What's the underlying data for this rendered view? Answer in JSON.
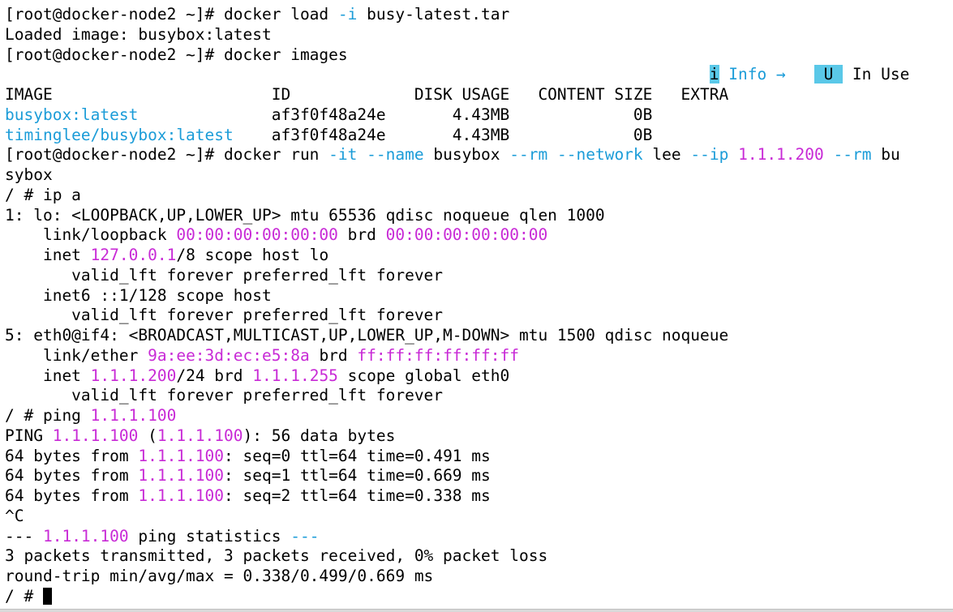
{
  "terminal": {
    "lines": [
      [
        {
          "t": "[root@docker-node2 ~]# docker load "
        },
        {
          "t": "-i",
          "c": "cyan"
        },
        {
          "t": " busy-latest.tar"
        }
      ],
      [
        {
          "t": "Loaded image: busybox:latest"
        }
      ],
      [
        {
          "t": "[root@docker-node2 ~]# docker images"
        }
      ],
      [
        {
          "t": "                                                                          "
        },
        {
          "t": "i",
          "c": "legend-i"
        },
        {
          "t": " Info → ",
          "c": "legend-info"
        },
        {
          "t": "  "
        },
        {
          "t": " U ",
          "c": "legend-u"
        },
        {
          "t": " In Use"
        }
      ],
      [
        {
          "t": "IMAGE                       ID             DISK USAGE   CONTENT SIZE   EXTRA"
        }
      ],
      [
        {
          "t": "busybox:latest",
          "c": "cyan"
        },
        {
          "t": "              af3f0f48a24e       4.43MB             0B"
        }
      ],
      [
        {
          "t": "timinglee/busybox:latest",
          "c": "cyan"
        },
        {
          "t": "    af3f0f48a24e       4.43MB             0B"
        }
      ],
      [
        {
          "t": "[root@docker-node2 ~]# docker run "
        },
        {
          "t": "-it",
          "c": "cyan"
        },
        {
          "t": " "
        },
        {
          "t": "--name",
          "c": "cyan"
        },
        {
          "t": " busybox "
        },
        {
          "t": "--rm",
          "c": "cyan"
        },
        {
          "t": " "
        },
        {
          "t": "--network",
          "c": "cyan"
        },
        {
          "t": " lee "
        },
        {
          "t": "--ip",
          "c": "cyan"
        },
        {
          "t": " "
        },
        {
          "t": "1.1.1.200",
          "c": "mag"
        },
        {
          "t": " "
        },
        {
          "t": "--rm",
          "c": "cyan"
        },
        {
          "t": " bu"
        }
      ],
      [
        {
          "t": "sybox"
        }
      ],
      [
        {
          "t": "/ # ip a"
        }
      ],
      [
        {
          "t": "1: lo: <LOOPBACK,UP,LOWER_UP> mtu 65536 qdisc noqueue qlen 1000"
        }
      ],
      [
        {
          "t": "    link/loopback "
        },
        {
          "t": "00:00:00:00:00:00",
          "c": "mag"
        },
        {
          "t": " brd "
        },
        {
          "t": "00:00:00:00:00:00",
          "c": "mag"
        }
      ],
      [
        {
          "t": "    inet "
        },
        {
          "t": "127.0.0.1",
          "c": "mag"
        },
        {
          "t": "/8 scope host lo"
        }
      ],
      [
        {
          "t": "       valid_lft forever preferred_lft forever"
        }
      ],
      [
        {
          "t": "    inet6 ::1/128 scope host"
        }
      ],
      [
        {
          "t": "       valid_lft forever preferred_lft forever"
        }
      ],
      [
        {
          "t": "5: eth0@if4: <BROADCAST,MULTICAST,UP,LOWER_UP,M-DOWN> mtu 1500 qdisc noqueue"
        }
      ],
      [
        {
          "t": "    link/ether "
        },
        {
          "t": "9a:ee:3d:ec:e5:8a",
          "c": "mag"
        },
        {
          "t": " brd "
        },
        {
          "t": "ff:ff:ff:ff:ff:ff",
          "c": "mag"
        }
      ],
      [
        {
          "t": "    inet "
        },
        {
          "t": "1.1.1.200",
          "c": "mag"
        },
        {
          "t": "/24 brd "
        },
        {
          "t": "1.1.1.255",
          "c": "mag"
        },
        {
          "t": " scope global eth0"
        }
      ],
      [
        {
          "t": "       valid_lft forever preferred_lft forever"
        }
      ],
      [
        {
          "t": "/ # ping "
        },
        {
          "t": "1.1.1.100",
          "c": "mag"
        }
      ],
      [
        {
          "t": "PING "
        },
        {
          "t": "1.1.1.100",
          "c": "mag"
        },
        {
          "t": " ("
        },
        {
          "t": "1.1.1.100",
          "c": "mag"
        },
        {
          "t": "): 56 data bytes"
        }
      ],
      [
        {
          "t": "64 bytes from "
        },
        {
          "t": "1.1.1.100",
          "c": "mag"
        },
        {
          "t": ": seq=0 ttl=64 time=0.491 ms"
        }
      ],
      [
        {
          "t": "64 bytes from "
        },
        {
          "t": "1.1.1.100",
          "c": "mag"
        },
        {
          "t": ": seq=1 ttl=64 time=0.669 ms"
        }
      ],
      [
        {
          "t": "64 bytes from "
        },
        {
          "t": "1.1.1.100",
          "c": "mag"
        },
        {
          "t": ": seq=2 ttl=64 time=0.338 ms"
        }
      ],
      [
        {
          "t": "^C"
        }
      ],
      [
        {
          "t": "--- "
        },
        {
          "t": "1.1.1.100",
          "c": "mag"
        },
        {
          "t": " ping statistics "
        },
        {
          "t": "---",
          "c": "cyan"
        }
      ],
      [
        {
          "t": "3 packets transmitted, 3 packets received, 0% packet loss"
        }
      ],
      [
        {
          "t": "round-trip min/avg/max = 0.338/0.499/0.669 ms"
        }
      ],
      [
        {
          "t": "/ # "
        },
        {
          "t": "",
          "c": "cursor"
        }
      ]
    ]
  },
  "colors": {
    "cyan": "#1b9cd8",
    "magenta": "#c82ad6",
    "legend_bg": "#5ac8e8",
    "background": "#ffffff",
    "foreground": "#000000"
  }
}
